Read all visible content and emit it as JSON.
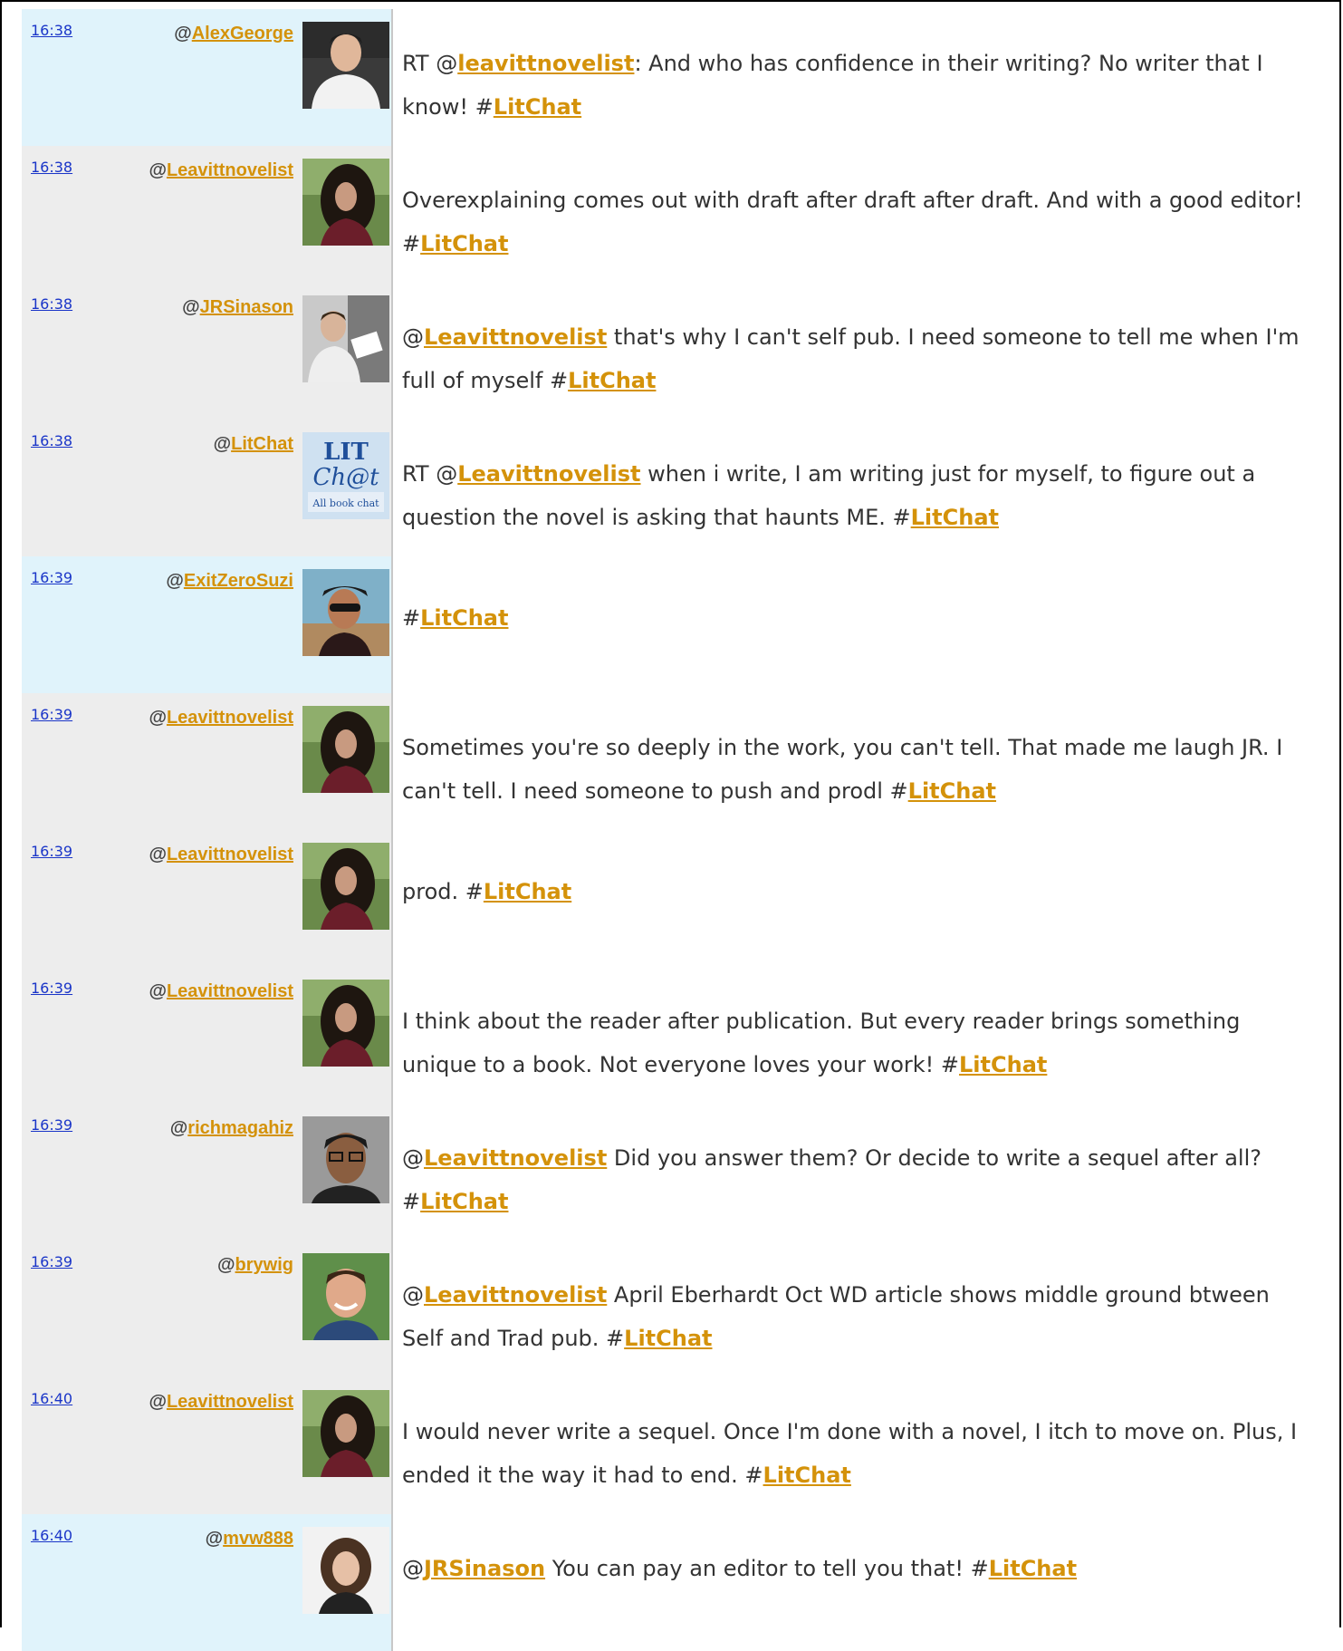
{
  "colors": {
    "blue_row": "#e0f3fb",
    "grey_row": "#ededed",
    "link_orange": "#d4920a",
    "time_blue": "#1a35c8"
  },
  "tweets": [
    {
      "time": "16:38",
      "user": "AlexGeorge",
      "avatar": "man-white-shirt-avatar",
      "row": "blue",
      "parts": [
        {
          "t": "RT @"
        },
        {
          "l": "leavittnovelist"
        },
        {
          "t": ": And who has confidence in their writing? No writer that I know! #"
        },
        {
          "l": "LitChat"
        }
      ]
    },
    {
      "time": "16:38",
      "user": "Leavittnovelist",
      "avatar": "curly-hair-woman-avatar",
      "row": "grey",
      "parts": [
        {
          "t": "Overexplaining comes out with draft after draft after draft. And with a good editor! #"
        },
        {
          "l": "LitChat"
        }
      ]
    },
    {
      "time": "16:38",
      "user": "JRSinason",
      "avatar": "man-reading-avatar",
      "row": "grey",
      "parts": [
        {
          "t": "@"
        },
        {
          "l": "Leavittnovelist"
        },
        {
          "t": " that's why I can't self pub. I need someone to tell me when I'm full of myself #"
        },
        {
          "l": "LitChat"
        }
      ]
    },
    {
      "time": "16:38",
      "user": "LitChat",
      "avatar": "litchat-logo-avatar",
      "row": "grey",
      "logo": {
        "line1": "LIT",
        "line2": "Ch@t",
        "line3": "All book chat"
      },
      "parts": [
        {
          "t": "RT @"
        },
        {
          "l": "Leavittnovelist"
        },
        {
          "t": " when i write, I am writing just for myself, to figure out a question the novel is asking that haunts ME. #"
        },
        {
          "l": "LitChat"
        }
      ]
    },
    {
      "time": "16:39",
      "user": "ExitZeroSuzi",
      "avatar": "woman-sunglasses-avatar",
      "row": "blue",
      "parts": [
        {
          "t": "#"
        },
        {
          "l": "LitChat"
        }
      ]
    },
    {
      "time": "16:39",
      "user": "Leavittnovelist",
      "avatar": "curly-hair-woman-avatar",
      "row": "grey",
      "parts": [
        {
          "t": "Sometimes you're so deeply in the work, you can't tell. That made me laugh JR. I can't tell. I need someone to push and prodl #"
        },
        {
          "l": "LitChat"
        }
      ]
    },
    {
      "time": "16:39",
      "user": "Leavittnovelist",
      "avatar": "curly-hair-woman-avatar",
      "row": "grey",
      "parts": [
        {
          "t": "prod. #"
        },
        {
          "l": "LitChat"
        }
      ]
    },
    {
      "time": "16:39",
      "user": "Leavittnovelist",
      "avatar": "curly-hair-woman-avatar",
      "row": "grey",
      "parts": [
        {
          "t": "I think about the reader after publication. But every reader brings something unique to a book. Not everyone loves your work! #"
        },
        {
          "l": "LitChat"
        }
      ]
    },
    {
      "time": "16:39",
      "user": "richmagahiz",
      "avatar": "man-glasses-avatar",
      "row": "grey",
      "parts": [
        {
          "t": "@"
        },
        {
          "l": "Leavittnovelist"
        },
        {
          "t": " Did you answer them? Or decide to write a sequel after all? #"
        },
        {
          "l": "LitChat"
        }
      ]
    },
    {
      "time": "16:39",
      "user": "brywig",
      "avatar": "smiling-man-avatar",
      "row": "grey",
      "parts": [
        {
          "t": "@"
        },
        {
          "l": "Leavittnovelist"
        },
        {
          "t": " April Eberhardt Oct WD article shows middle ground btween Self and Trad pub. #"
        },
        {
          "l": "LitChat"
        }
      ]
    },
    {
      "time": "16:40",
      "user": "Leavittnovelist",
      "avatar": "curly-hair-woman-avatar",
      "row": "grey",
      "parts": [
        {
          "t": "I would never write a sequel. Once I'm done with a novel, I itch to move on. Plus, I ended it the way it had to end. #"
        },
        {
          "l": "LitChat"
        }
      ]
    },
    {
      "time": "16:40",
      "user": "mvw888",
      "avatar": "woman-bob-hair-avatar",
      "row": "blue",
      "parts": [
        {
          "t": "@"
        },
        {
          "l": "JRSinason"
        },
        {
          "t": " You can pay an editor to tell you that! #"
        },
        {
          "l": "LitChat"
        }
      ]
    }
  ]
}
